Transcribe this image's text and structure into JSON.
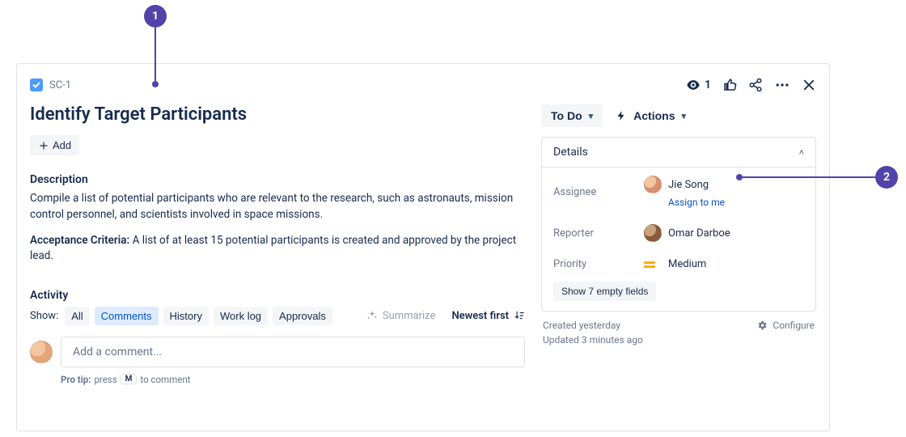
{
  "annotations": {
    "marker1": "1",
    "marker2": "2"
  },
  "issue": {
    "key": "SC-1",
    "title": "Identify Target Participants",
    "watchers": "1"
  },
  "toolbar": {
    "add_label": "Add"
  },
  "description": {
    "heading": "Description",
    "body": "Compile a list of potential participants who are relevant to the research, such as astronauts, mission control personnel, and scientists involved in space missions.",
    "criteria_label": "Acceptance Criteria:",
    "criteria_body": " A list of at least 15 potential participants is created and approved by the project lead."
  },
  "activity": {
    "heading": "Activity",
    "show_label": "Show:",
    "tabs": {
      "all": "All",
      "comments": "Comments",
      "history": "History",
      "worklog": "Work log",
      "approvals": "Approvals"
    },
    "summarize": "Summarize",
    "sort": "Newest first",
    "comment_placeholder": "Add a comment...",
    "protip_prefix": "Pro tip:",
    "protip_press": " press ",
    "protip_key": "M",
    "protip_suffix": " to comment"
  },
  "status": {
    "label": "To Do",
    "actions": "Actions"
  },
  "details": {
    "heading": "Details",
    "assignee_label": "Assignee",
    "assignee_name": "Jie Song",
    "assign_to_me": "Assign to me",
    "reporter_label": "Reporter",
    "reporter_name": "Omar Darboe",
    "priority_label": "Priority",
    "priority_value": "Medium",
    "empty_fields": "Show 7 empty fields"
  },
  "meta": {
    "created": "Created yesterday",
    "updated": "Updated 3 minutes ago",
    "configure": "Configure"
  }
}
